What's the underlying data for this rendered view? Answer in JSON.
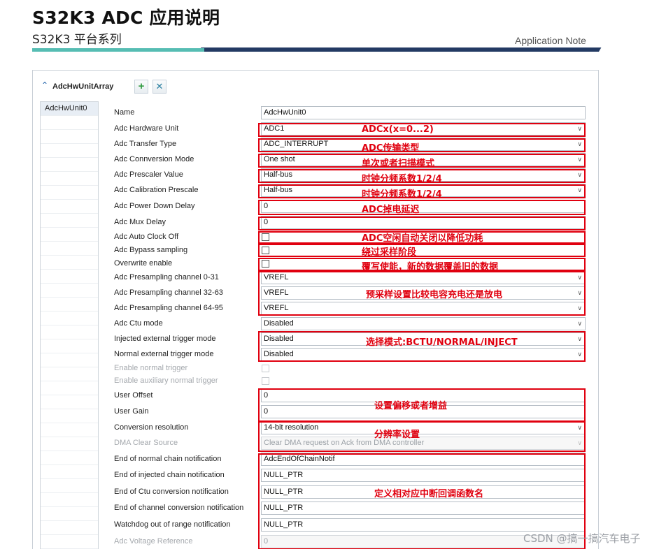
{
  "document": {
    "title": "S32K3 ADC 应用说明",
    "subtitle": "S32K3 平台系列",
    "doc_type": "Application Note"
  },
  "panel": {
    "title": "AdcHwUnitArray",
    "add_icon": "plus-icon",
    "remove_icon": "close-icon",
    "collapse_icon": "chevron-up-icon",
    "list_items": [
      "AdcHwUnit0"
    ]
  },
  "fields": [
    {
      "label": "Name",
      "type": "text",
      "value": "AdcHwUnit0"
    },
    {
      "label": "Adc Hardware Unit",
      "type": "select",
      "value": "ADC1"
    },
    {
      "label": "Adc Transfer Type",
      "type": "select",
      "value": "ADC_INTERRUPT"
    },
    {
      "label": "Adc Connversion Mode",
      "type": "select",
      "value": "One shot"
    },
    {
      "label": "Adc Prescaler Value",
      "type": "select",
      "value": "Half-bus"
    },
    {
      "label": "Adc Calibration Prescale",
      "type": "select",
      "value": "Half-bus"
    },
    {
      "label": "Adc Power Down Delay",
      "type": "text",
      "value": "0"
    },
    {
      "label": "Adc Mux Delay",
      "type": "text",
      "value": "0"
    },
    {
      "label": "Adc Auto Clock Off",
      "type": "checkbox",
      "checked": false
    },
    {
      "label": "Adc Bypass sampling",
      "type": "checkbox",
      "checked": false
    },
    {
      "label": "Overwrite enable",
      "type": "checkbox",
      "checked": false
    },
    {
      "label": "Adc Presampling channel 0-31",
      "type": "select",
      "value": "VREFL"
    },
    {
      "label": "Adc Presampling channel 32-63",
      "type": "select",
      "value": "VREFL"
    },
    {
      "label": "Adc Presampling channel 64-95",
      "type": "select",
      "value": "VREFL"
    },
    {
      "label": "Adc Ctu mode",
      "type": "select",
      "value": "Disabled"
    },
    {
      "label": "Injected external trigger mode",
      "type": "select",
      "value": "Disabled"
    },
    {
      "label": "Normal external trigger mode",
      "type": "select",
      "value": "Disabled"
    },
    {
      "label": "Enable normal trigger",
      "type": "checkbox",
      "checked": false,
      "disabled": true
    },
    {
      "label": "Enable auxiliary normal trigger",
      "type": "checkbox",
      "checked": false,
      "disabled": true
    },
    {
      "label": "User Offset",
      "type": "text",
      "value": "0"
    },
    {
      "label": "User Gain",
      "type": "text",
      "value": "0"
    },
    {
      "label": "Conversion resolution",
      "type": "select",
      "value": "14-bit resolution"
    },
    {
      "label": "DMA Clear Source",
      "type": "select",
      "value": "Clear DMA request on Ack from DMA controller",
      "disabled": true
    },
    {
      "label": "End of normal chain notification",
      "type": "text",
      "value": "AdcEndOfChainNotif"
    },
    {
      "label": "End of injected chain notification",
      "type": "text",
      "value": "NULL_PTR"
    },
    {
      "label": "End of Ctu conversion notification",
      "type": "text",
      "value": "NULL_PTR"
    },
    {
      "label": "End of channel conversion notification",
      "type": "text",
      "value": "NULL_PTR"
    },
    {
      "label": "Watchdog out of range notification",
      "type": "text",
      "value": "NULL_PTR"
    },
    {
      "label": "Adc Voltage Reference",
      "type": "text",
      "value": "0",
      "disabled": true
    }
  ],
  "annotations": {
    "hardware_unit": "ADCx(x=0...2)",
    "transfer_type": "ADC传输类型",
    "conversion_mode": "单次或者扫描模式",
    "prescaler": "时钟分频系数1/2/4",
    "calibration_prescale": "时钟分频系数1/2/4",
    "power_down_delay": "ADC掉电延迟",
    "auto_clock_off": "ADC空闲自动关闭以降低功耗",
    "bypass_sampling": "绕过采样阶段",
    "overwrite": "覆写使能，新的数据覆盖旧的数据",
    "presampling": "预采样设置比较电容充电还是放电",
    "trigger_mode": "选择模式:BCTU/NORMAL/INJECT",
    "offset_gain": "设置偏移或者增益",
    "resolution": "分辨率设置",
    "notifications": "定义相对应中断回调函数名"
  },
  "annotation_color": "#e0000f",
  "watermark": "CSDN @搞一搞汽车电子"
}
